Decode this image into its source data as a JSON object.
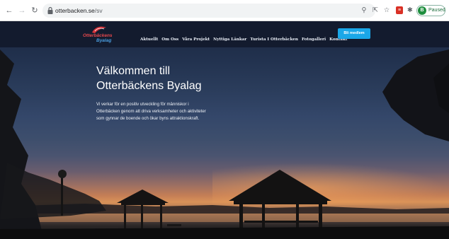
{
  "browser": {
    "url_domain": "otterbacken.se",
    "url_path": "/sv",
    "profile_initial": "B",
    "profile_label": "Paused",
    "icons": [
      "back-arrow-icon",
      "forward-arrow-icon",
      "reload-icon",
      "lock-icon",
      "search-icon",
      "share-icon",
      "star-icon",
      "pdf-extension-icon",
      "extensions-puzzle-icon"
    ]
  },
  "site": {
    "logo_line_1": "Otterbäckens",
    "logo_line_2": "Byalag",
    "nav": [
      "Aktuellt",
      "Om Oss",
      "Våra Projekt",
      "Nyttiga Länkar",
      "Turista I Otterbäcken",
      "Fotogalleri",
      "Kontakt"
    ],
    "cta_label": "Bli medlem",
    "accent_color": "#1aa7e8"
  },
  "hero": {
    "title_line_1": "Välkommen till",
    "title_line_2": "Otterbäckens Byalag",
    "description": "Vi verkar för en positiv utveckling för människor i Otterbäcken genom att driva verksamheter och aktiviteter som gynnar de boende och ökar byns attraktionskraft."
  }
}
